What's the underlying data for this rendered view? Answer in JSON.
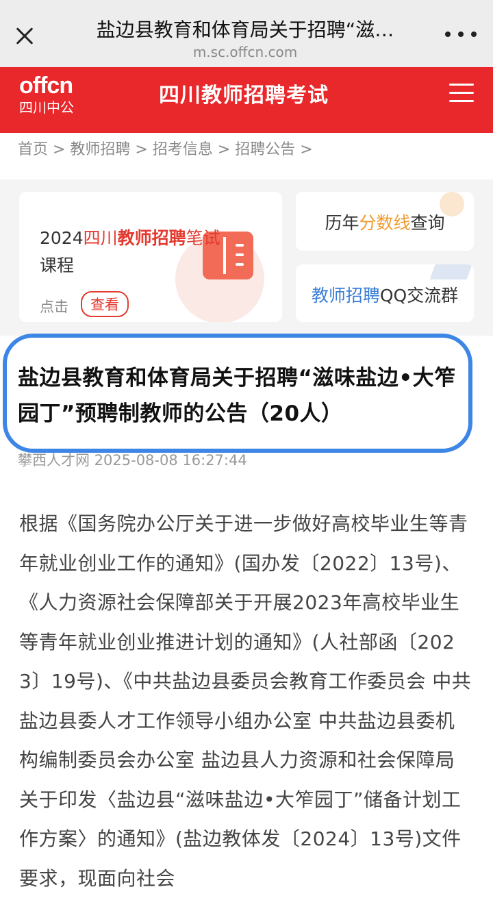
{
  "browser": {
    "title": "盐边县教育和体育局关于招聘“滋…",
    "url": "m.sc.offcn.com"
  },
  "header": {
    "logo_text": "offcn",
    "logo_sub": "四川中公",
    "site_title": "四川教师招聘考试",
    "brand_color": "#e8282b"
  },
  "breadcrumb": "首页 > 教师招聘 > 招考信息 > 招聘公告 >",
  "promo": {
    "big_card": {
      "year": "2024",
      "red_part1": "四川",
      "red_part2": "教师招聘",
      "rest": "笔试",
      "line2": "课程",
      "click": "点击",
      "view_button": "查看"
    },
    "score_card": {
      "pre": "历年",
      "highlight": "分数线",
      "post": "查询"
    },
    "qq_card": {
      "highlight": "教师招聘",
      "post": "QQ交流群"
    }
  },
  "article": {
    "title": "盐边县教育和体育局关于招聘“滋味盐边•大笮园丁”预聘制教师的公告（20人）",
    "source_time": "攀西人才网 2025-08-08 16:27:44",
    "body": "根据《国务院办公厅关于进一步做好高校毕业生等青年就业创业工作的通知》(国办发〔2022〕13号)、《人力资源社会保障部关于开展2023年高校毕业生等青年就业创业推进计划的通知》(人社部函〔2023〕19号)、《中共盐边县委员会教育工作委员会 中共盐边县委人才工作领导小组办公室 中共盐边县委机构编制委员会办公室 盐边县人力资源和社会保障局关于印发〈盐边县“滋味盐边•大笮园丁”储备计划工作方案〉的通知》(盐边教体发〔2024〕13号)文件要求，现面向社会"
  },
  "colors": {
    "highlight_border": "#3e86e6",
    "accent_red": "#e33a2f",
    "accent_orange": "#f09a2e",
    "accent_blue": "#3b7fd3"
  }
}
